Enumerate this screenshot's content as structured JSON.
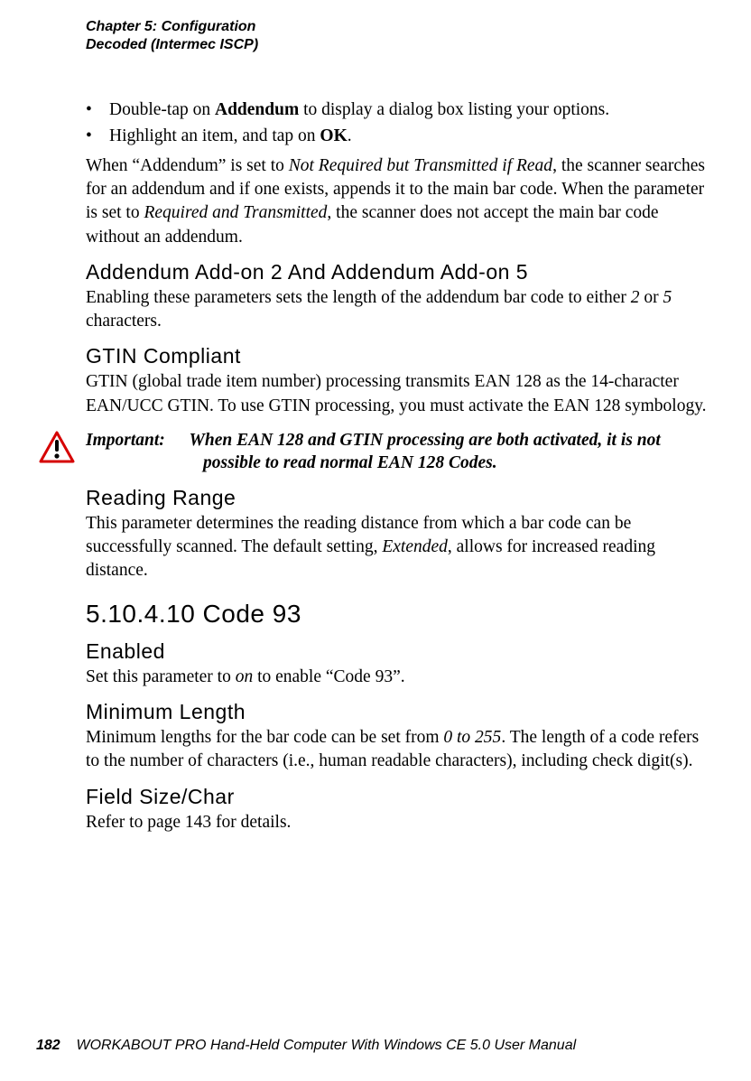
{
  "header": {
    "line1": "Chapter 5: Configuration",
    "line2": "Decoded (Intermec ISCP)"
  },
  "bullets": [
    {
      "pre": "Double-tap on ",
      "bold": "Addendum",
      "post": " to display a dialog box listing your options."
    },
    {
      "pre": "Highlight an item, and tap on ",
      "bold": "OK",
      "post": "."
    }
  ],
  "addendum_para": {
    "t1": "When “Addendum” is set to ",
    "i1": "Not Required but Transmitted if Read",
    "t2": ", the scanner searches for an addendum and if one exists, appends it to the main bar code. When the parameter is set to ",
    "i2": "Required and Transmitted",
    "t3": ", the scanner does not accept the main bar code without an addendum."
  },
  "h_addendum25": "Addendum Add-on 2 And Addendum Add-on 5",
  "p_addendum25": {
    "t1": "Enabling these parameters sets the length of the addendum bar code to either ",
    "i1": "2",
    "t2": " or ",
    "i2": "5",
    "t3": " characters."
  },
  "h_gtin": "GTIN Compliant",
  "p_gtin": "GTIN (global trade item number) processing transmits EAN 128 as the 14-character EAN/UCC GTIN. To use GTIN processing, you must activate the EAN 128 symbology.",
  "important": {
    "label": "Important:",
    "line1": "When EAN 128 and GTIN processing are both activated, it is not",
    "line2": "possible to read normal EAN 128 Codes."
  },
  "h_reading": "Reading Range",
  "p_reading": {
    "t1": "This parameter determines the reading distance from which a bar code can be successfully scanned. The default setting, ",
    "i1": "Extended",
    "t2": ", allows for increased reading distance."
  },
  "h_code93": "5.10.4.10 Code 93",
  "h_enabled": "Enabled",
  "p_enabled": {
    "t1": "Set this parameter to ",
    "i1": "on",
    "t2": " to enable “Code 93”."
  },
  "h_minlen": "Minimum Length",
  "p_minlen": {
    "t1": "Minimum lengths for the bar code can be set from ",
    "i1": "0 to 255",
    "t2": ". The length of a code refers to the number of characters (i.e., human readable characters), including check digit(s)."
  },
  "h_field": "Field Size/Char",
  "p_field": "Refer to page 143 for details.",
  "footer": {
    "page": "182",
    "title": "WORKABOUT PRO Hand-Held Computer With Windows CE 5.0 User Manual"
  }
}
